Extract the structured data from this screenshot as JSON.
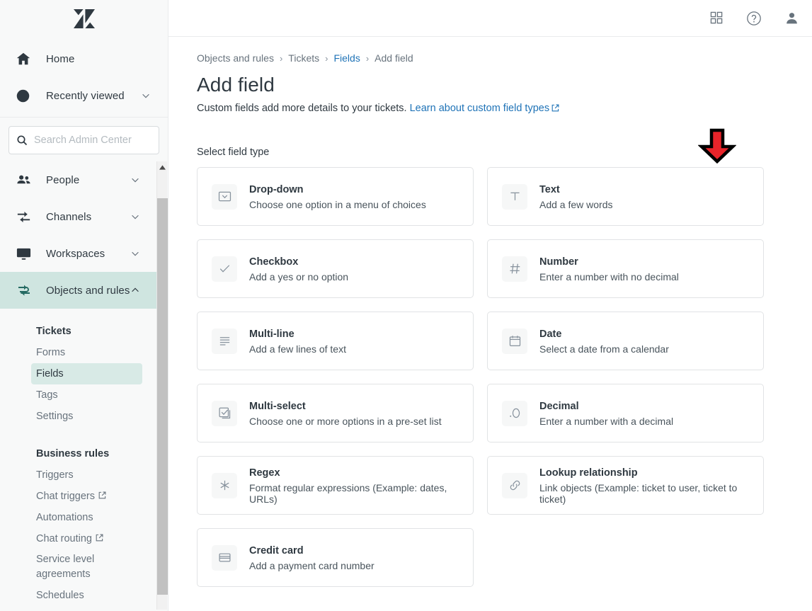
{
  "sidebar": {
    "logo": "zendesk-logo",
    "primary": [
      {
        "label": "Home",
        "icon": "home-icon",
        "chevron": false,
        "active": false
      },
      {
        "label": "Recently viewed",
        "icon": "clock-icon",
        "chevron": true,
        "active": false
      }
    ],
    "search": {
      "placeholder": "Search Admin Center",
      "value": "",
      "icon": "search-icon"
    },
    "sections": [
      {
        "label": "People",
        "icon": "people-icon",
        "chevron": "down",
        "active": false
      },
      {
        "label": "Channels",
        "icon": "channels-icon",
        "chevron": "down",
        "active": false
      },
      {
        "label": "Workspaces",
        "icon": "workspaces-icon",
        "chevron": "down",
        "active": false
      },
      {
        "label": "Objects and rules",
        "icon": "objects-and-rules-icon",
        "chevron": "up",
        "active": true
      }
    ],
    "groups": [
      {
        "heading": "Tickets",
        "items": [
          {
            "label": "Forms",
            "external": false,
            "selected": false
          },
          {
            "label": "Fields",
            "external": false,
            "selected": true
          },
          {
            "label": "Tags",
            "external": false,
            "selected": false
          },
          {
            "label": "Settings",
            "external": false,
            "selected": false
          }
        ]
      },
      {
        "heading": "Business rules",
        "items": [
          {
            "label": "Triggers",
            "external": false,
            "selected": false
          },
          {
            "label": "Chat triggers",
            "external": true,
            "selected": false
          },
          {
            "label": "Automations",
            "external": false,
            "selected": false
          },
          {
            "label": "Chat routing",
            "external": true,
            "selected": false
          },
          {
            "label": "Service level agreements",
            "external": false,
            "selected": false
          },
          {
            "label": "Schedules",
            "external": false,
            "selected": false
          }
        ]
      }
    ]
  },
  "topbar": {
    "icons": [
      {
        "name": "apps-grid-icon"
      },
      {
        "name": "help-icon"
      },
      {
        "name": "user-avatar-icon"
      }
    ]
  },
  "breadcrumb": [
    {
      "label": "Objects and rules",
      "link": false
    },
    {
      "label": "Tickets",
      "link": false
    },
    {
      "label": "Fields",
      "link": true
    },
    {
      "label": "Add field",
      "link": false
    }
  ],
  "breadcrumb_separator": "›",
  "page": {
    "title": "Add field",
    "subtitle_text": "Custom fields add more details to your tickets.",
    "subtitle_link": "Learn about custom field types",
    "section_label": "Select field type"
  },
  "field_types": [
    {
      "column": "left",
      "title": "Drop-down",
      "desc": "Choose one option in a menu of choices",
      "icon": "dropdown-icon"
    },
    {
      "column": "right",
      "title": "Text",
      "desc": "Add a few words",
      "icon": "text-icon"
    },
    {
      "column": "left",
      "title": "Checkbox",
      "desc": "Add a yes or no option",
      "icon": "checkbox-icon"
    },
    {
      "column": "right",
      "title": "Number",
      "desc": "Enter a number with no decimal",
      "icon": "number-icon"
    },
    {
      "column": "left",
      "title": "Multi-line",
      "desc": "Add a few lines of text",
      "icon": "multiline-icon"
    },
    {
      "column": "right",
      "title": "Date",
      "desc": "Select a date from a calendar",
      "icon": "calendar-icon"
    },
    {
      "column": "left",
      "title": "Multi-select",
      "desc": "Choose one or more options in a pre-set list",
      "icon": "multiselect-icon"
    },
    {
      "column": "right",
      "title": "Decimal",
      "desc": "Enter a number with a decimal",
      "icon": "decimal-icon"
    },
    {
      "column": "left",
      "title": "Regex",
      "desc": "Format regular expressions (Example: dates, URLs)",
      "icon": "regex-icon"
    },
    {
      "column": "right",
      "title": "Lookup relationship",
      "desc": "Link objects (Example: ticket to user, ticket to ticket)",
      "icon": "link-icon"
    },
    {
      "column": "left",
      "title": "Credit card",
      "desc": "Add a payment card number",
      "icon": "credit-card-icon"
    }
  ],
  "annotation": {
    "type": "arrow-down",
    "color": "#E8242A",
    "outline": "#000000",
    "points_at": "Text"
  },
  "colors": {
    "accent_teal": "#cfe5e0",
    "selected_mint": "#d8eae6",
    "link_blue": "#1f73b7",
    "text_primary": "#2f3941",
    "text_muted": "#68737d",
    "sidebar_bg": "#f8f9f9",
    "card_border": "#e1e3e5"
  }
}
